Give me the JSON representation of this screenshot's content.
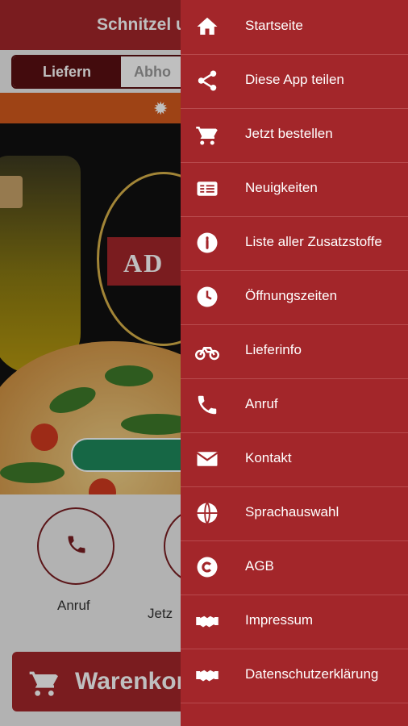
{
  "app": {
    "title": "Schnitzel u"
  },
  "segment": {
    "left_label": "Liefern",
    "right_label": "Abho"
  },
  "hero": {
    "brand": "AD"
  },
  "actions": [
    {
      "label": "Anruf"
    },
    {
      "label": "Jetz"
    }
  ],
  "cart": {
    "label": "Warenkorl"
  },
  "drawer": {
    "items": [
      {
        "icon": "home-icon",
        "label": "Startseite"
      },
      {
        "icon": "share-icon",
        "label": "Diese App teilen"
      },
      {
        "icon": "cart-icon",
        "label": "Jetzt bestellen"
      },
      {
        "icon": "news-icon",
        "label": "Neuigkeiten"
      },
      {
        "icon": "info-icon",
        "label": "Liste aller Zusatzstoffe"
      },
      {
        "icon": "clock-icon",
        "label": "Öffnungszeiten"
      },
      {
        "icon": "motorbike-icon",
        "label": "Lieferinfo"
      },
      {
        "icon": "phone-icon",
        "label": "Anruf"
      },
      {
        "icon": "envelope-icon",
        "label": "Kontakt"
      },
      {
        "icon": "globe-icon",
        "label": "Sprachauswahl"
      },
      {
        "icon": "copyright-icon",
        "label": "AGB"
      },
      {
        "icon": "handshake-icon",
        "label": "Impressum"
      },
      {
        "icon": "handshake-icon",
        "label": "Datenschutzerklärung"
      }
    ]
  },
  "colors": {
    "primary": "#a3262a",
    "dark": "#5a0f12",
    "accent": "#d35a1c",
    "green": "#1e8a5c"
  }
}
